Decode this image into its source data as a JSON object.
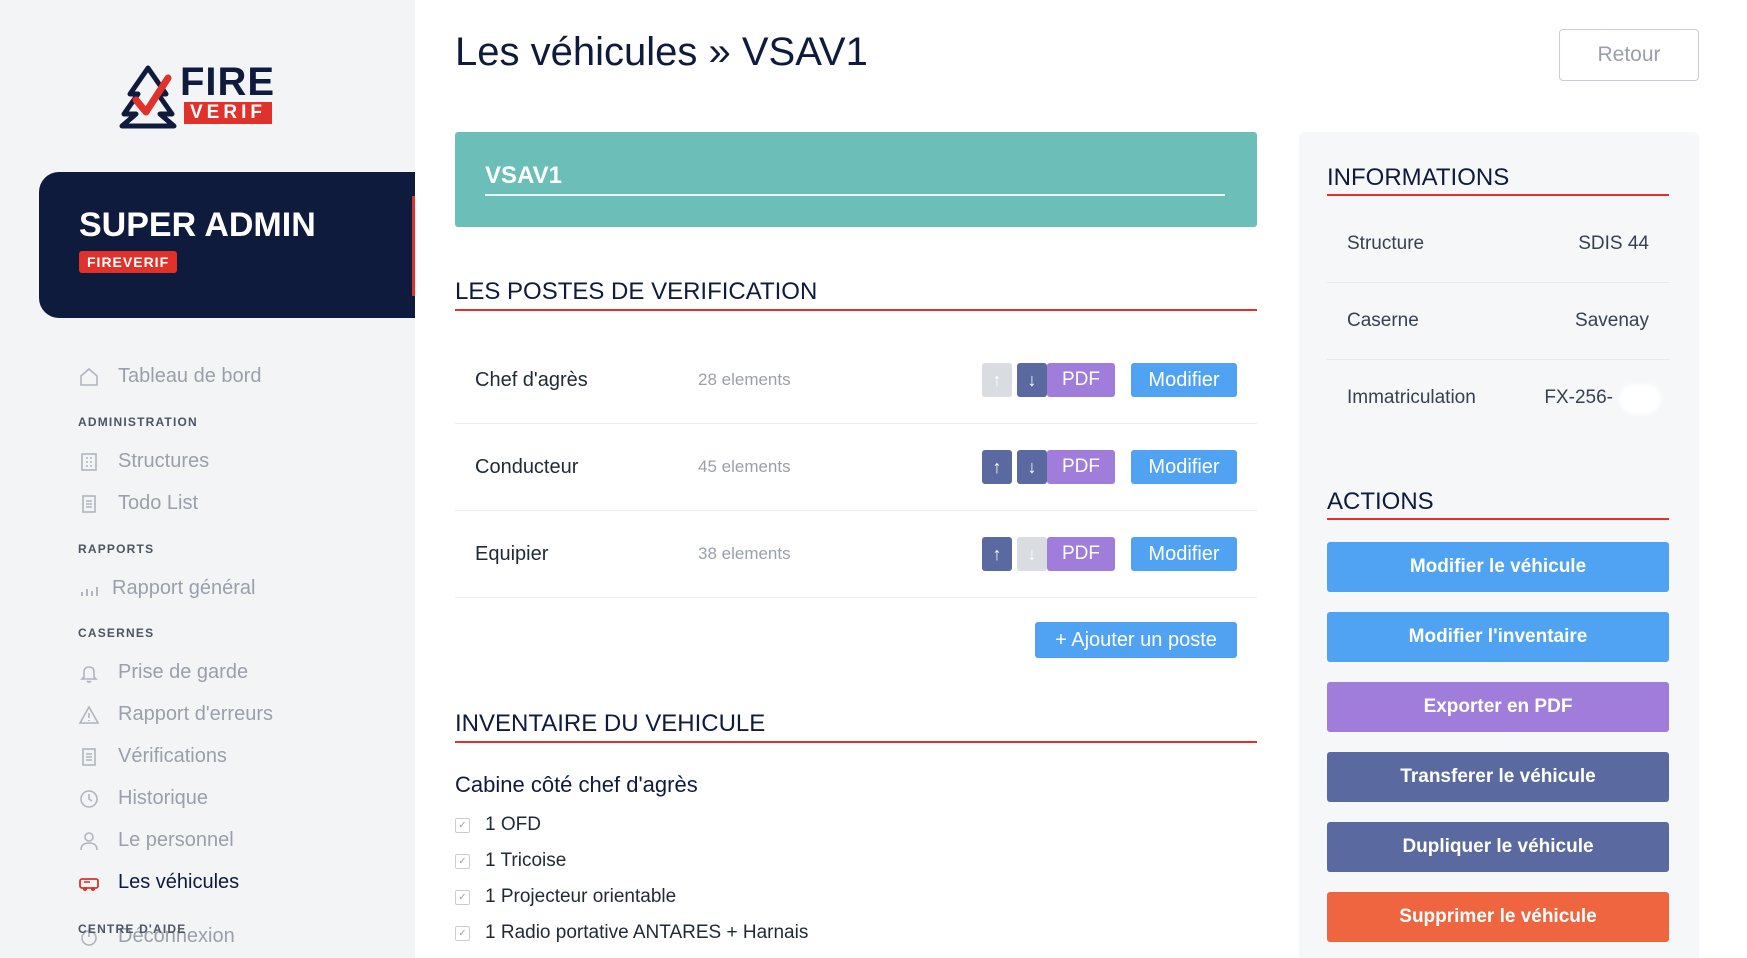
{
  "brand": {
    "line1": "FIRE",
    "line2": "VERIF",
    "colors": {
      "navy": "#0f1b3d",
      "red": "#e0312b"
    }
  },
  "user": {
    "role": "SUPER ADMIN",
    "org": "FIREVERIF"
  },
  "nav": {
    "dashboard": "Tableau de bord",
    "sections": {
      "admin": "ADMINISTRATION",
      "reports": "RAPPORTS",
      "stations": "CASERNES",
      "help": "CENTRE D'AIDE"
    },
    "admin_items": [
      {
        "label": "Structures",
        "icon": "building-icon"
      },
      {
        "label": "Todo List",
        "icon": "list-icon"
      }
    ],
    "report_items": [
      {
        "label": "Rapport général",
        "icon": "bar-chart-icon"
      }
    ],
    "station_items": [
      {
        "label": "Prise de garde",
        "icon": "bell-icon"
      },
      {
        "label": "Rapport d'erreurs",
        "icon": "warning-icon"
      },
      {
        "label": "Vérifications",
        "icon": "checklist-icon"
      },
      {
        "label": "Historique",
        "icon": "history-icon"
      },
      {
        "label": "Le personnel",
        "icon": "person-icon"
      },
      {
        "label": "Les véhicules",
        "icon": "truck-icon"
      }
    ],
    "logout": "Déconnexion"
  },
  "page": {
    "title": "Les véhicules » VSAV1",
    "back_label": "Retour"
  },
  "vehicle": {
    "name": "VSAV1"
  },
  "postes": {
    "title": "LES POSTES DE VERIFICATION",
    "pdf_label": "PDF",
    "edit_label": "Modifier",
    "up_glyph": "↑",
    "down_glyph": "↓",
    "items": [
      {
        "name": "Chef d'agrès",
        "count": "28 elements",
        "up_enabled": false,
        "down_enabled": true
      },
      {
        "name": "Conducteur",
        "count": "45 elements",
        "up_enabled": true,
        "down_enabled": true
      },
      {
        "name": "Equipier",
        "count": "38 elements",
        "up_enabled": true,
        "down_enabled": false
      }
    ],
    "add_label": "+ Ajouter un poste"
  },
  "inventory": {
    "title": "INVENTAIRE DU VEHICULE",
    "groups": [
      {
        "name": "Cabine côté chef d'agrès",
        "items": [
          "1 OFD",
          "1 Tricoise",
          "1 Projecteur orientable",
          "1 Radio portative ANTARES + Harnais"
        ]
      }
    ]
  },
  "info": {
    "title": "INFORMATIONS",
    "rows": [
      {
        "label": "Structure",
        "value": "SDIS 44"
      },
      {
        "label": "Caserne",
        "value": "Savenay"
      },
      {
        "label": "Immatriculation",
        "value": "FX-256-"
      }
    ]
  },
  "actions": {
    "title": "ACTIONS",
    "buttons": [
      {
        "label": "Modifier le véhicule",
        "color": "#4fa3f2"
      },
      {
        "label": "Modifier l'inventaire",
        "color": "#4fa3f2"
      },
      {
        "label": "Exporter en PDF",
        "color": "#a07ddb"
      },
      {
        "label": "Transferer le véhicule",
        "color": "#5a6aa0"
      },
      {
        "label": "Dupliquer le véhicule",
        "color": "#5a6aa0"
      },
      {
        "label": "Supprimer le véhicule",
        "color": "#ef6540"
      }
    ]
  }
}
